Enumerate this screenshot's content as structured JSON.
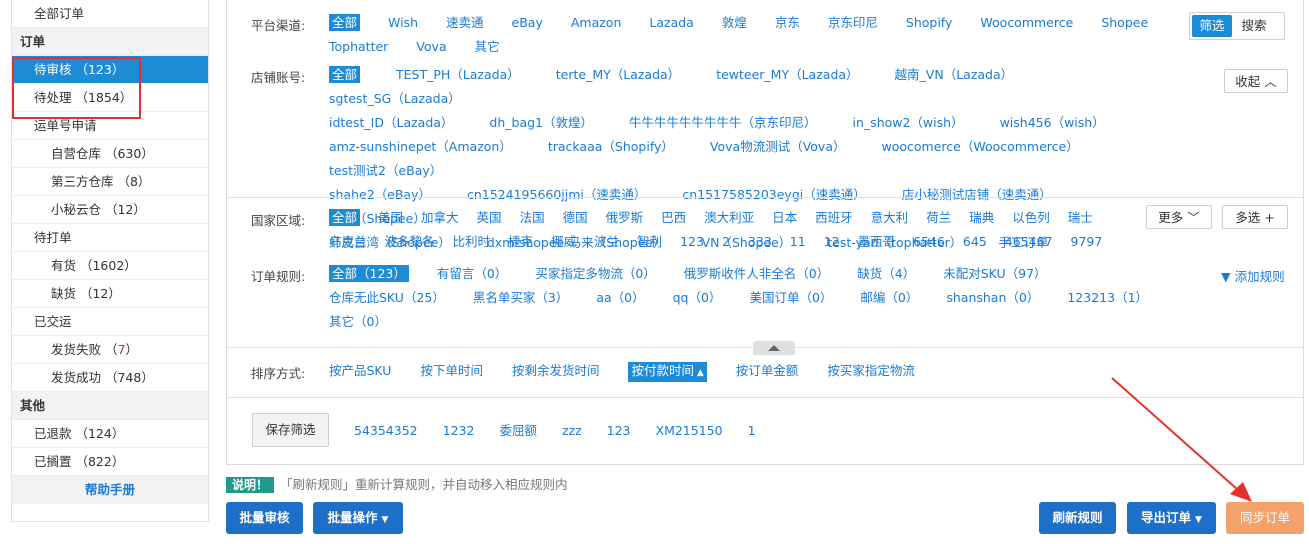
{
  "sidebar": {
    "all_orders": "全部订单",
    "section_orders": "订单",
    "pending_review": "待审核 （123）",
    "pending_process": "待处理 （1854）",
    "waybill_apply": "运单号申请",
    "own_warehouse": "自营仓库 （630）",
    "third_warehouse": "第三方仓库 （8）",
    "cloud_warehouse": "小秘云仓 （12）",
    "to_print": "待打单",
    "in_stock": "有货 （1602）",
    "out_stock": "缺货 （12）",
    "shipped": "已交运",
    "ship_fail_label": "发货失败 （",
    "ship_fail_count": "7",
    "ship_fail_end": "）",
    "ship_success": "发货成功 （748）",
    "section_other": "其他",
    "refunded": "已退款 （124）",
    "shelved": "已搁置 （822）",
    "help": "帮助手册"
  },
  "filters": {
    "platform_label": "平台渠道:",
    "platforms": [
      "全部",
      "Wish",
      "速卖通",
      "eBay",
      "Amazon",
      "Lazada",
      "敦煌",
      "京东",
      "京东印尼",
      "Shopify",
      "Woocommerce",
      "Shopee",
      "Tophatter",
      "Vova",
      "其它"
    ],
    "store_label": "店铺账号:",
    "stores_row1": [
      "全部",
      "TEST_PH（Lazada）",
      "terte_MY（Lazada）",
      "tewteer_MY（Lazada）",
      "越南_VN（Lazada）",
      "sgtest_SG（Lazada）"
    ],
    "stores_row2": [
      "idtest_ID（Lazada）",
      "dh_bag1（敦煌）",
      "牛牛牛牛牛牛牛牛牛（京东印尼）",
      "in_show2（wish）",
      "wish456（wish）"
    ],
    "stores_row3": [
      "amz-sunshinepet（Amazon）",
      "trackaaa（Shopify）",
      "Vova物流测试（Vova）",
      "woocomerce（Woocommerce）",
      "test测试2（eBay）"
    ],
    "stores_row4": [
      "shahe2（eBay）",
      "cn1524195660jjmi（速卖通）",
      "cn1517585203eygi（速卖通）",
      "店小秘测试店铺（速卖通）",
      "泰国（Shopee）"
    ],
    "stores_row5": [
      "虾皮台湾（Shopee）",
      "dxm-shopee-马来（Shopee）",
      "VN（Shopee）",
      "test-yan（tophatter）",
      "手工订单"
    ],
    "country_label": "国家区域:",
    "countries_row1": [
      "全部",
      "美国",
      "加拿大",
      "英国",
      "法国",
      "德国",
      "俄罗斯",
      "巴西",
      "澳大利亚",
      "日本",
      "西班牙",
      "意大利",
      "荷兰",
      "瑞典",
      "以色列",
      "瑞士"
    ],
    "countries_row2": [
      "乌克兰",
      "波多黎各",
      "比利时",
      "捷克",
      "挪威",
      "波兰",
      "智利",
      "123",
      "2",
      "333",
      "11",
      "12",
      "墨西哥",
      "6546",
      "645",
      "465467",
      "9797"
    ],
    "rule_label": "订单规则:",
    "rules_row1": [
      "全部（123）",
      "有留言（0）",
      "买家指定多物流（0）",
      "俄罗斯收件人非全名（0）",
      "缺货（4）",
      "未配对SKU（97）"
    ],
    "rules_row2": [
      "仓库无此SKU（25）",
      "黑名单买家（3）",
      "aa（0）",
      "qq（0）",
      "美国订单（0）",
      "邮编（0）",
      "shanshan（0）",
      "123213（1）"
    ],
    "rules_row3": [
      "其它（0）"
    ],
    "add_rule": "添加规则",
    "sort_label": "排序方式:",
    "sort_options": [
      "按产品SKU",
      "按下单时间",
      "按剩余发货时间",
      "按付款时间",
      "按订单金额",
      "按买家指定物流"
    ],
    "save_filter": "保存筛选",
    "saved_filters": [
      "54354352",
      "1232",
      "委屈额",
      "zzz",
      "123",
      "XM215150",
      "1"
    ],
    "toggle_filter": "筛选",
    "toggle_search": "搜索",
    "collapse": "收起",
    "more": "更多",
    "multi": "多选"
  },
  "bottom": {
    "note_tag": "说明！",
    "note_text": "「刷新规则」重新计算规则，并自动移入相应规则内",
    "batch_review": "批量审核",
    "batch_ops": "批量操作",
    "refresh_rules": "刷新规则",
    "export_orders": "导出订单",
    "sync_orders": "同步订单"
  },
  "colors": {
    "accent": "#1e8bd6",
    "button": "#1e6fc8",
    "sync": "#f4a26b",
    "highlight": "#e63030"
  }
}
